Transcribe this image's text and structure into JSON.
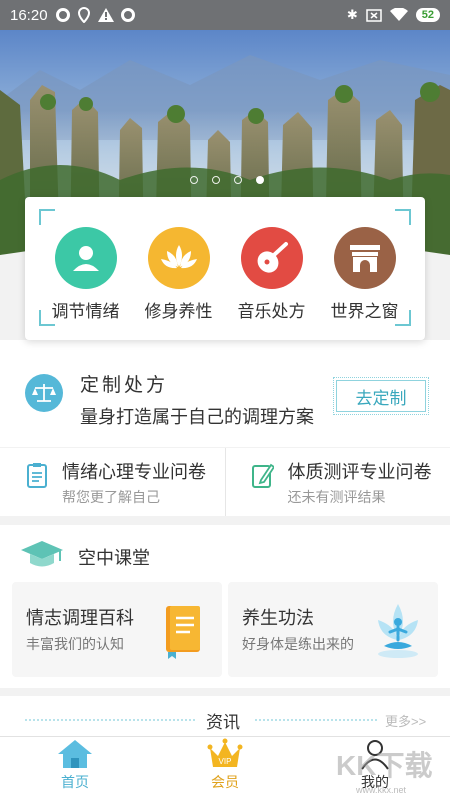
{
  "status_bar": {
    "time": "16:20",
    "battery": "52"
  },
  "banner": {
    "slides_count": 4,
    "active_index": 3
  },
  "categories": [
    {
      "label": "调节情绪",
      "icon": "person-icon",
      "color": "#3cc8a6"
    },
    {
      "label": "修身养性",
      "icon": "lotus-icon",
      "color": "#f5b731"
    },
    {
      "label": "音乐处方",
      "icon": "pipa-icon",
      "color": "#e24b43"
    },
    {
      "label": "世界之窗",
      "icon": "arch-icon",
      "color": "#9a6246"
    }
  ],
  "custom": {
    "title": "定制处方",
    "desc": "量身打造属于自己的调理方案",
    "button": "去定制"
  },
  "questionnaires": [
    {
      "title": "情绪心理专业问卷",
      "sub": "帮您更了解自己",
      "icon": "clipboard-icon"
    },
    {
      "title": "体质测评专业问卷",
      "sub": "还未有测评结果",
      "icon": "pencil-paper-icon"
    }
  ],
  "classroom": {
    "title": "空中课堂",
    "cards": [
      {
        "title": "情志调理百科",
        "sub": "丰富我们的认知",
        "icon": "book-icon"
      },
      {
        "title": "养生功法",
        "sub": "好身体是练出来的",
        "icon": "meditation-icon"
      }
    ]
  },
  "news": {
    "title": "资讯",
    "more": "更多>>"
  },
  "nav": [
    {
      "label": "首页",
      "icon": "home-icon"
    },
    {
      "label": "会员",
      "icon": "vip-crown-icon"
    },
    {
      "label": "我的",
      "icon": "user-icon"
    }
  ],
  "watermark": {
    "text": "KK下载",
    "url": "www.kkx.net"
  },
  "colors": {
    "accent": "#4bb0d0",
    "vip": "#e0a21c"
  }
}
